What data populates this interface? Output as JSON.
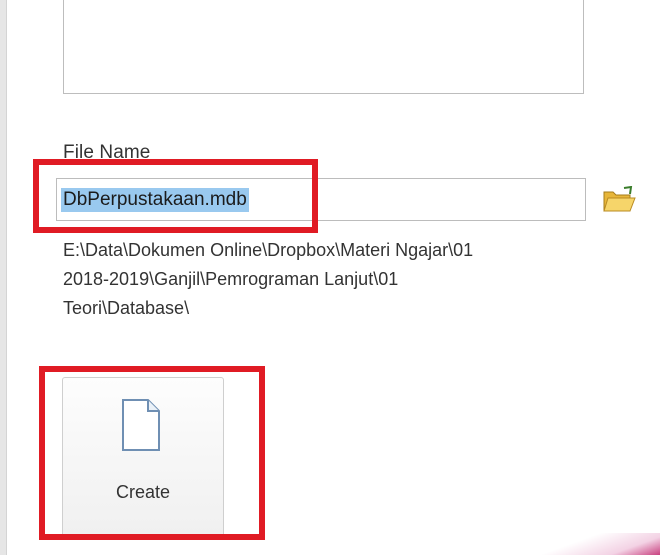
{
  "file_section": {
    "label": "File Name",
    "filename_value": "DbPerpustakaan.mdb",
    "browse_icon": "folder-open-icon"
  },
  "path": {
    "line1": "E:\\Data\\Dokumen Online\\Dropbox\\Materi Ngajar\\01",
    "line2": "2018-2019\\Ganjil\\Pemrograman Lanjut\\01",
    "line3": "Teori\\Database\\"
  },
  "create_button": {
    "label": "Create",
    "icon": "blank-document-icon"
  },
  "colors": {
    "highlight": "#e01b24",
    "selection": "#99c9ef"
  }
}
